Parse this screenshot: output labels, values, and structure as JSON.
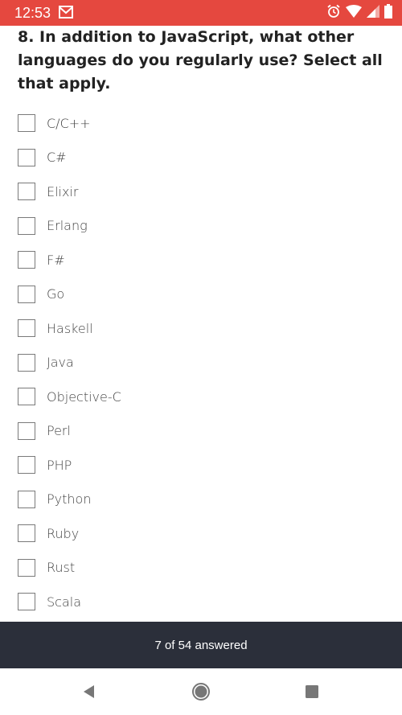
{
  "status_bar": {
    "time": "12:53",
    "color": "#e5483f",
    "icons": [
      "gmail-icon",
      "alarm-icon",
      "wifi-icon",
      "signal-icon",
      "battery-icon"
    ]
  },
  "question": {
    "text": "8. In addition to JavaScript, what other languages do you regularly use? Select all that apply."
  },
  "options": [
    {
      "label": "C/C++",
      "checked": false
    },
    {
      "label": "C#",
      "checked": false
    },
    {
      "label": "Elixir",
      "checked": false
    },
    {
      "label": "Erlang",
      "checked": false
    },
    {
      "label": "F#",
      "checked": false
    },
    {
      "label": "Go",
      "checked": false
    },
    {
      "label": "Haskell",
      "checked": false
    },
    {
      "label": "Java",
      "checked": false
    },
    {
      "label": "Objective-C",
      "checked": false
    },
    {
      "label": "Perl",
      "checked": false
    },
    {
      "label": "PHP",
      "checked": false
    },
    {
      "label": "Python",
      "checked": false
    },
    {
      "label": "Ruby",
      "checked": false
    },
    {
      "label": "Rust",
      "checked": false
    },
    {
      "label": "Scala",
      "checked": false
    }
  ],
  "progress": {
    "text": "7 of 54 answered",
    "answered": 7,
    "total": 54,
    "color": "#2b2f3a"
  },
  "nav_bar": {
    "icons": [
      "back-icon",
      "home-icon",
      "recents-icon"
    ]
  }
}
